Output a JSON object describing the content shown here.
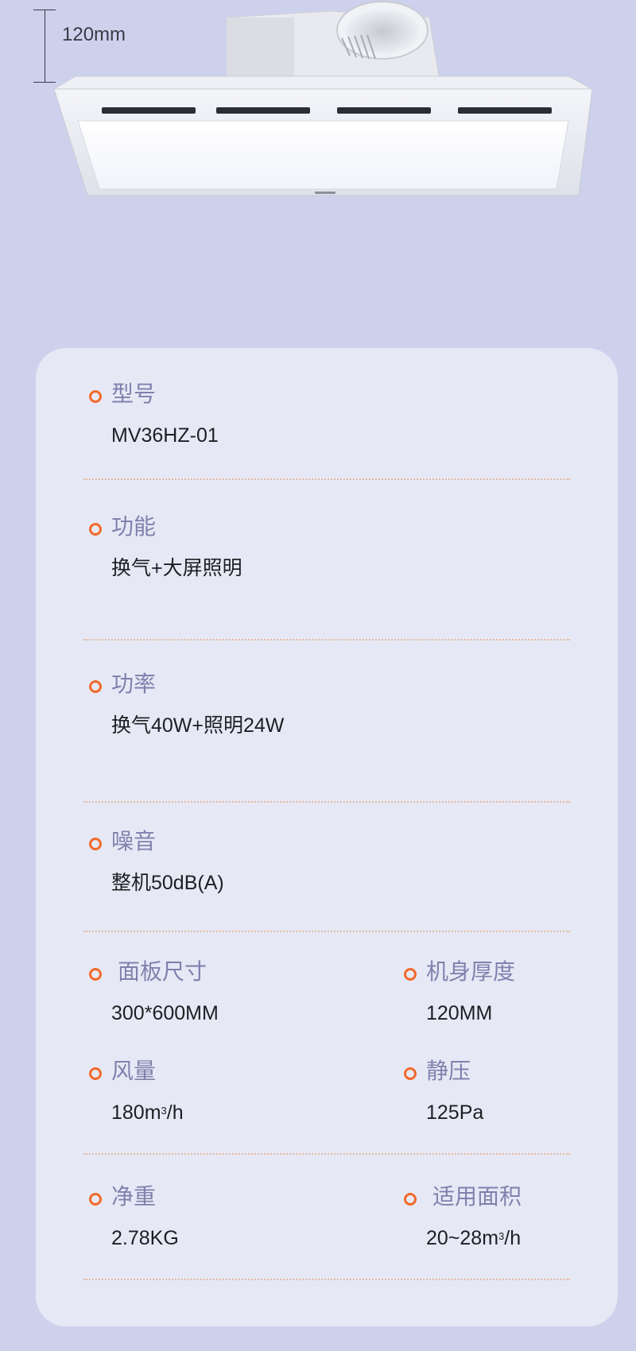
{
  "dimension_label": "120mm",
  "specs": {
    "model": {
      "label": "型号",
      "value": "MV36HZ-01"
    },
    "function": {
      "label": "功能",
      "value": "换气+大屏照明"
    },
    "power": {
      "label": "功率",
      "value": "换气40W+照明24W"
    },
    "noise": {
      "label": "噪音",
      "value": "整机50dB(A)"
    },
    "panel_size": {
      "label": "面板尺寸",
      "value": "300*600MM"
    },
    "body_thickness": {
      "label": "机身厚度",
      "value": "120MM"
    },
    "airflow": {
      "label": "风量",
      "value_num": "180m",
      "value_sup": "3",
      "value_unit": "/h"
    },
    "static_pressure": {
      "label": "静压",
      "value": "125Pa"
    },
    "net_weight": {
      "label": "净重",
      "value": "2.78KG"
    },
    "applicable_area": {
      "label": "适用面积",
      "value_num": "20~28m",
      "value_sup": "3",
      "value_unit": "/h"
    }
  },
  "colors": {
    "background": "#cdd1ec",
    "card": "#e6e9f5",
    "bullet": "#f26a2c",
    "label": "#7f81ad",
    "value": "#1e1e24",
    "divider": "#e6b8a0"
  }
}
